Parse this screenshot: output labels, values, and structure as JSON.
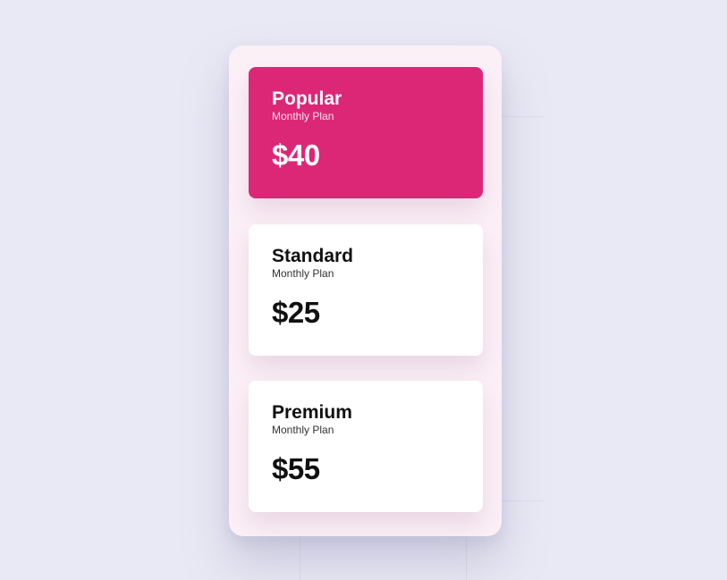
{
  "colors": {
    "background": "#e9e9f5",
    "panel": "#fcf0f7",
    "accent": "#dc2777",
    "card": "#ffffff"
  },
  "plans": [
    {
      "name": "Popular",
      "period": "Monthly Plan",
      "price": "$40",
      "highlighted": true
    },
    {
      "name": "Standard",
      "period": "Monthly Plan",
      "price": "$25",
      "highlighted": false
    },
    {
      "name": "Premium",
      "period": "Monthly Plan",
      "price": "$55",
      "highlighted": false
    }
  ]
}
